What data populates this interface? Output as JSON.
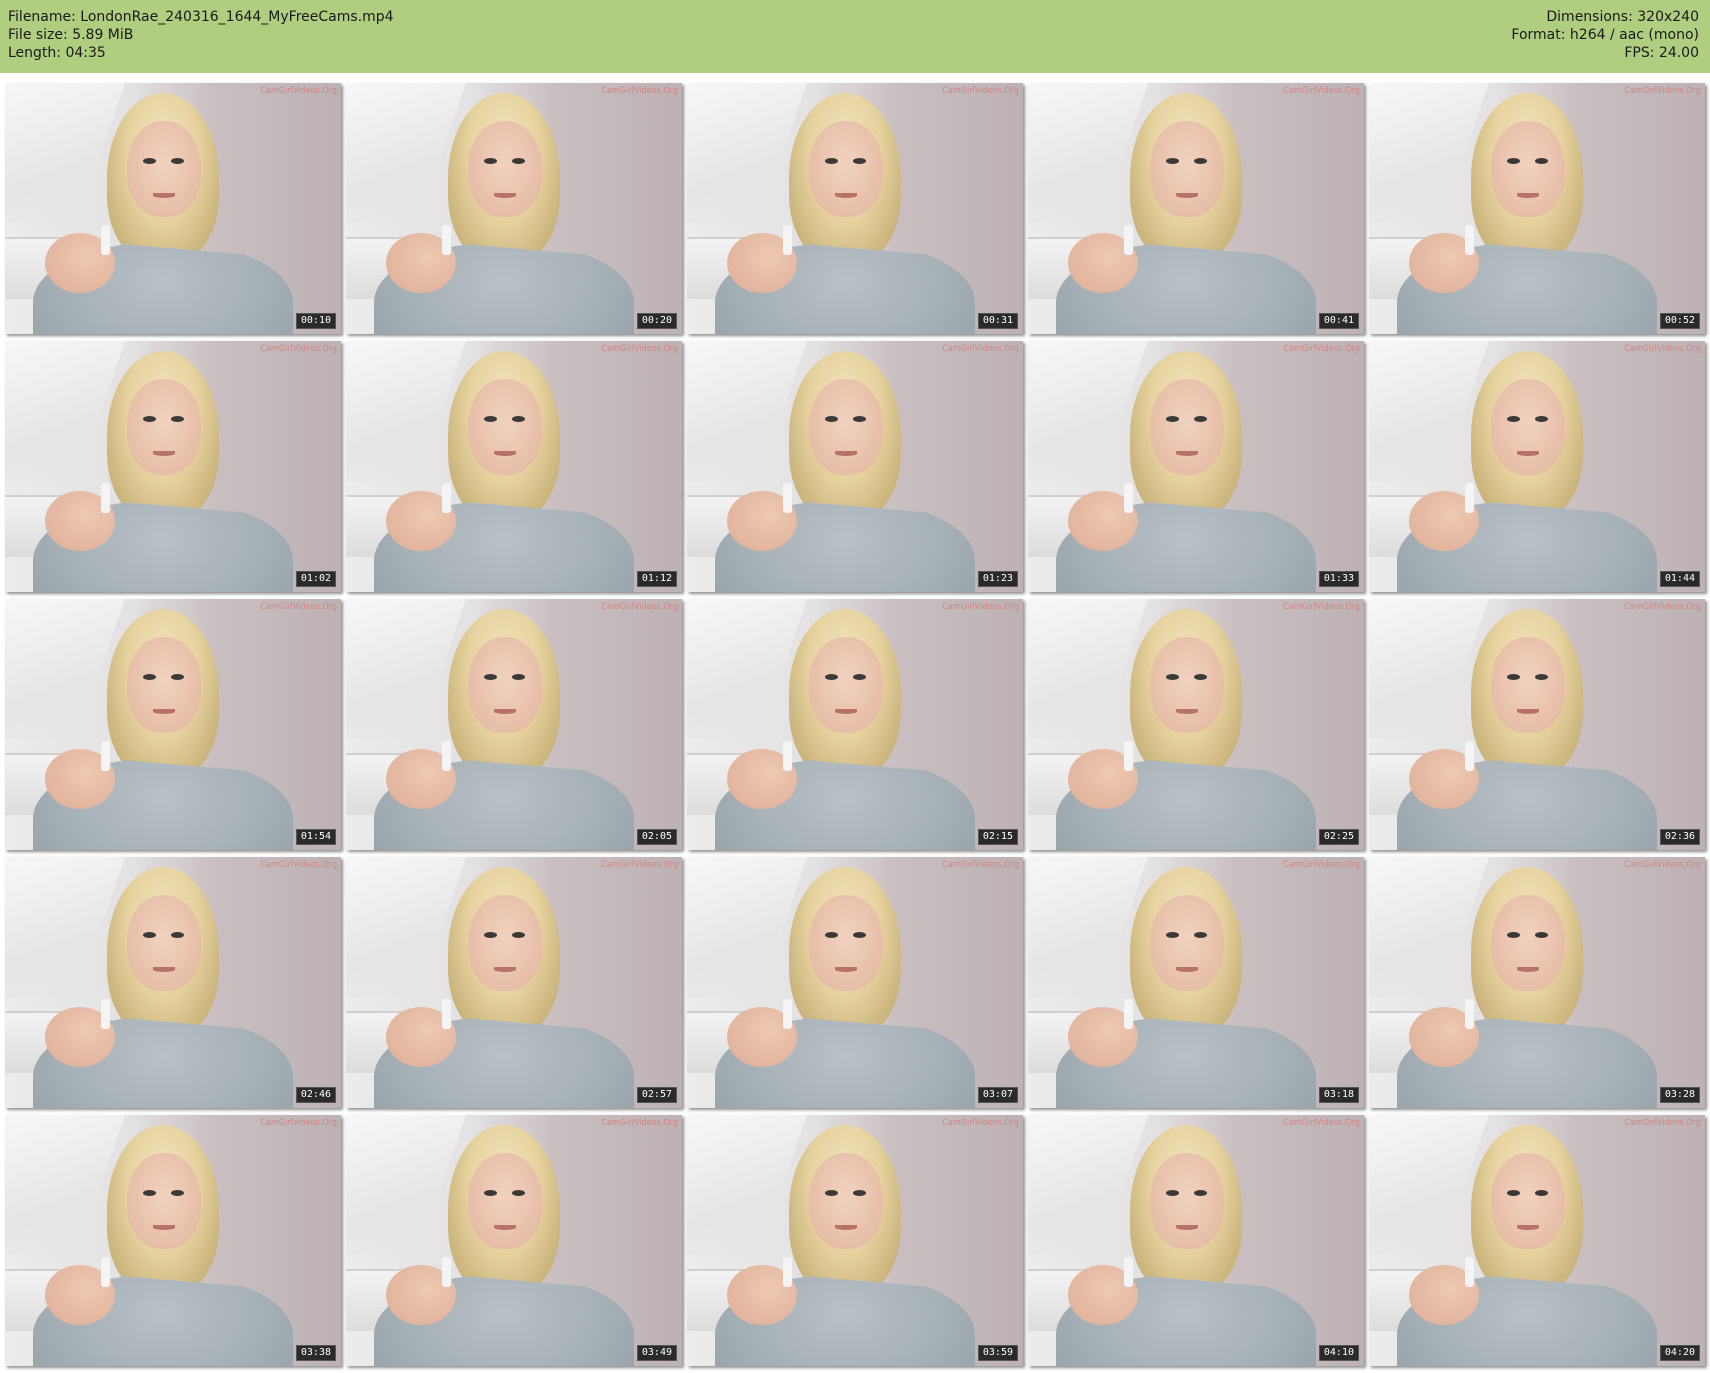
{
  "header": {
    "filename": "Filename: LondonRae_240316_1644_MyFreeCams.mp4",
    "filesize": "File size: 5.89 MiB",
    "length": "Length: 04:35",
    "dimensions": "Dimensions: 320x240",
    "format": "Format: h264 / aac (mono)",
    "fps": "FPS: 24.00"
  },
  "colors": {
    "header_bg": "#b0cd80",
    "page_bg": "#ffffff",
    "timestamp_bg": "#2a2a2a",
    "watermark": "#d77b7b"
  },
  "thumbnails": [
    {
      "time": "00:10",
      "watermark": "CamGirlVideos.Org"
    },
    {
      "time": "00:20",
      "watermark": "CamGirlVideos.Org"
    },
    {
      "time": "00:31",
      "watermark": "CamGirlVideos.Org"
    },
    {
      "time": "00:41",
      "watermark": "CamGirlVideos.Org"
    },
    {
      "time": "00:52",
      "watermark": "CamGirlVideos.Org"
    },
    {
      "time": "01:02",
      "watermark": "CamGirlVideos.Org"
    },
    {
      "time": "01:12",
      "watermark": "CamGirlVideos.Org"
    },
    {
      "time": "01:23",
      "watermark": "CamGirlVideos.Org"
    },
    {
      "time": "01:33",
      "watermark": "CamGirlVideos.Org"
    },
    {
      "time": "01:44",
      "watermark": "CamGirlVideos.Org"
    },
    {
      "time": "01:54",
      "watermark": "CamGirlVideos.Org"
    },
    {
      "time": "02:05",
      "watermark": "CamGirlVideos.Org"
    },
    {
      "time": "02:15",
      "watermark": "CamGirlVideos.Org"
    },
    {
      "time": "02:25",
      "watermark": "CamGirlVideos.Org"
    },
    {
      "time": "02:36",
      "watermark": "CamGirlVideos.Org"
    },
    {
      "time": "02:46",
      "watermark": "CamGirlVideos.Org"
    },
    {
      "time": "02:57",
      "watermark": "CamGirlVideos.Org"
    },
    {
      "time": "03:07",
      "watermark": "CamGirlVideos.Org"
    },
    {
      "time": "03:18",
      "watermark": "CamGirlVideos.Org"
    },
    {
      "time": "03:28",
      "watermark": "CamGirlVideos.Org"
    },
    {
      "time": "03:38",
      "watermark": "CamGirlVideos.Org"
    },
    {
      "time": "03:49",
      "watermark": "CamGirlVideos.Org"
    },
    {
      "time": "03:59",
      "watermark": "CamGirlVideos.Org"
    },
    {
      "time": "04:10",
      "watermark": "CamGirlVideos.Org"
    },
    {
      "time": "04:20",
      "watermark": "CamGirlVideos.Org"
    }
  ]
}
